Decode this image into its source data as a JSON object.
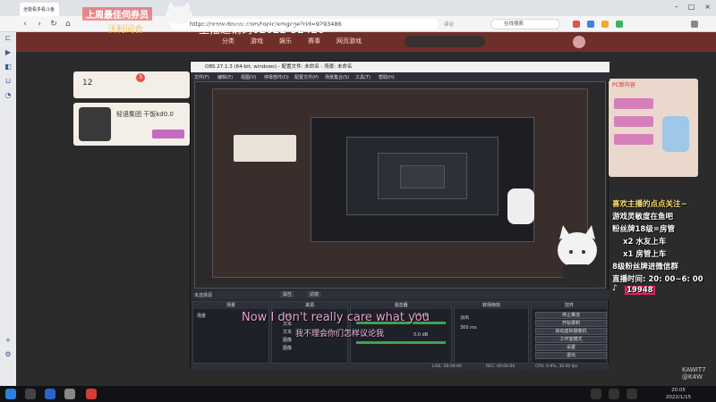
{
  "browser": {
    "tab_title": "全能看多看斗鱼",
    "url": "https://www.douyu.com/topic/xmgcge?rid=9293486",
    "search_placeholder": "在线搜索",
    "address_prefix": "评论"
  },
  "site": {
    "nav": [
      "分类",
      "游戏",
      "娱乐",
      "赛事",
      "消息",
      "活动",
      "直播",
      "网页游戏"
    ],
    "ad_title": "上周最佳伺券员",
    "ad_sub": "沃利间合",
    "ad_banner": "主播邀请码02022-52420",
    "stats": {
      "followers": "12",
      "rank": "3"
    },
    "streamer_name": "轻语集团 干饭kd0.0",
    "pc_badge": "PC新内容"
  },
  "overlay": {
    "line1": "喜欢主播的点点关注~",
    "line2": "游戏灵敏度在鱼吧",
    "line3": "粉丝牌18级=房管",
    "line4": "x2 水友上车",
    "line5": "x1 房管上车",
    "line6": "8级粉丝牌进微信群",
    "line7": "直播时间: 20: 00~6: 00",
    "tiktok_id": "19948",
    "icon": "tiktok-icon"
  },
  "obs": {
    "title": "OBS 27.1.3 (64-bit, windows) - 配置文件: 未命名 - 场景: 未命名",
    "menu": [
      "文件(F)",
      "编辑(E)",
      "视图(V)",
      "停靠部件(D)",
      "配置文件(P)",
      "场景集合(S)",
      "工具(T)",
      "帮助(H)"
    ],
    "no_source": "未选择源",
    "properties": "属性",
    "filters": "滤镜",
    "docks": {
      "scenes": {
        "title": "场景",
        "items": [
          "场景"
        ]
      },
      "sources": {
        "title": "来源",
        "items": [
          "文本",
          "文本",
          "文本",
          "图像",
          "图像"
        ]
      },
      "mixer": {
        "title": "混音器",
        "items": [
          "0.0 dB",
          "0.0 dB"
        ]
      },
      "transitions": {
        "title": "转场特效",
        "items": [
          "淡出",
          "300 ms"
        ]
      },
      "controls": {
        "title": "控件",
        "items": [
          "停止推流",
          "开始录制",
          "启动虚拟摄像机",
          "工作室模式",
          "设置",
          "退出"
        ]
      }
    },
    "footer": {
      "live": "LIVE: 00:00:00",
      "rec": "REC: 00:00:00",
      "cpu": "CPU: 0.9%, 30.00 fps"
    }
  },
  "subtitles": {
    "en": "Now I don't really care what you",
    "cn": "我不理会你们怎样议论我"
  },
  "watermark": {
    "line1": "KAWIT7",
    "line2": "@K4W"
  },
  "taskbar": {
    "time": "20:05",
    "date": "2022/1/15"
  },
  "colors": {
    "site_header": "#6e2e2a",
    "obs_bg": "#272a33",
    "taskbar": "#101215"
  }
}
